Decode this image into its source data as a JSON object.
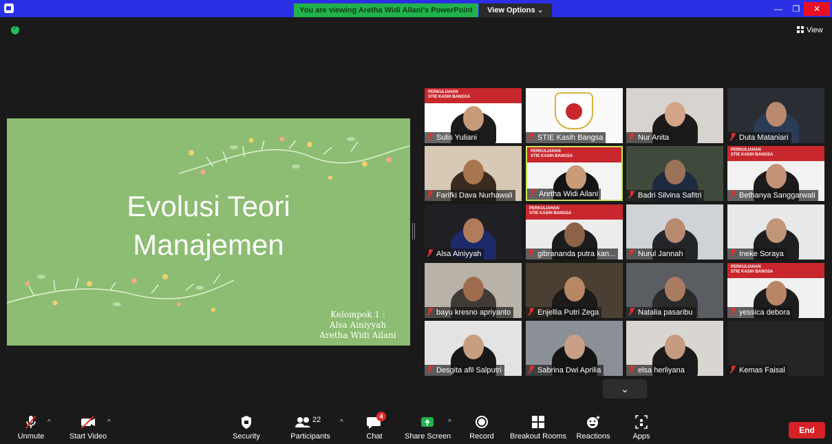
{
  "window": {
    "share_banner": "You are viewing Aretha Widi Ailani's PowerPoint",
    "view_options": "View Options ⌄",
    "minimize": "—",
    "maximize": "❐",
    "close": "✕"
  },
  "top_right": {
    "view_label": "View"
  },
  "slide": {
    "title_line1": "Evolusi Teori",
    "title_line2": "Manajemen",
    "group_line1": "Kelompok 1 :",
    "group_line2": "Alsa Ainiyyah",
    "group_line3": "Aretha Widi Ailani"
  },
  "banner_text": {
    "line1": "PERKULIAHAN",
    "line2": "STIE KASIH BANGSA"
  },
  "participants": [
    "Sulis Yuliani",
    "STIE Kasih Bangsa",
    "Nur Anita",
    "Duta Mataniari",
    "Farifki Dava Nurhawali",
    "Aretha Widi Ailani",
    "Badri Silvina Safitri",
    "Bethanya Sanggarwati",
    "Alsa Ainiyyah",
    "gibrananda putra kan...",
    "Nurul Jannah",
    "Ineke Soraya",
    "bayu kresno apriyanto",
    "Enjellia Putri Zega",
    "Natalia pasaribu",
    "yessica debora",
    "Desgita afil Salputri",
    "Sabrina Dwi Aprilia",
    "elsa herliyana",
    "Kemas Faisal"
  ],
  "more_button": "⌄",
  "toolbar": {
    "unmute": "Unmute",
    "start_video": "Start Video",
    "security": "Security",
    "participants": "Participants",
    "participants_count": "22",
    "chat": "Chat",
    "chat_badge": "4",
    "share_screen": "Share Screen",
    "record": "Record",
    "breakout_rooms": "Breakout Rooms",
    "reactions": "Reactions",
    "apps": "Apps",
    "end": "End"
  },
  "colors": {
    "accent_blue": "#2b30e6",
    "share_green": "#22b24c",
    "end_red": "#d42227",
    "slide_green": "#8cbd72",
    "active_speaker": "#c7e55a"
  }
}
